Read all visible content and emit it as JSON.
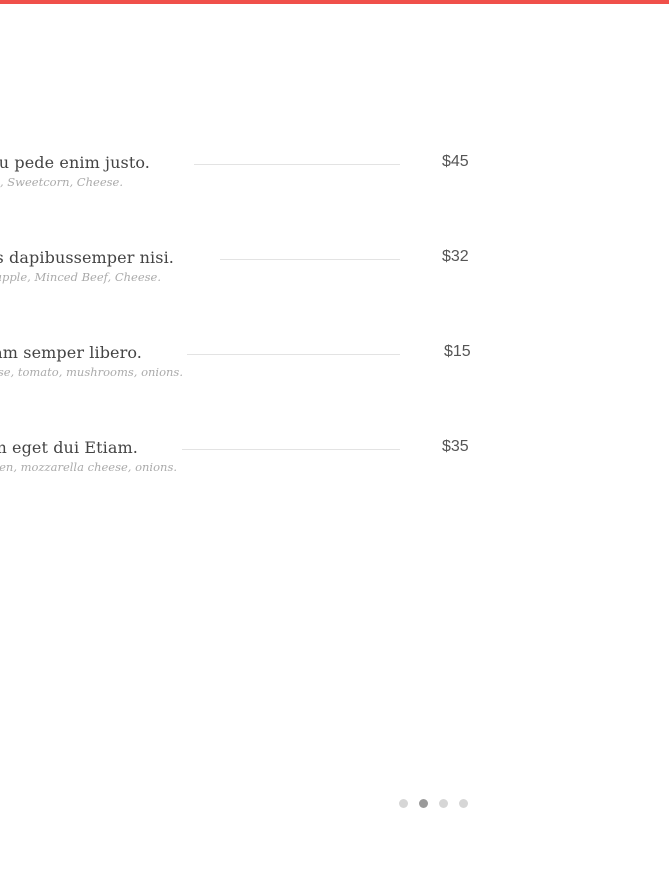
{
  "accent_color": "#f0504a",
  "menu": {
    "items": [
      {
        "name": "cu pede enim justo.",
        "description": "a, Sweetcorn, Cheese.",
        "price": "$45"
      },
      {
        "name": "as dapibussemper nisi.",
        "description": "eapple, Minced Beef, Cheese.",
        "price": "$32"
      },
      {
        "name": "am semper libero.",
        "description": "ese, tomato, mushrooms, onions.",
        "price": "$15"
      },
      {
        "name": "m eget dui Etiam.",
        "description": "cken, mozzarella cheese, onions.",
        "price": "$35"
      }
    ]
  },
  "pager": {
    "count": 4,
    "active_index": 1
  }
}
